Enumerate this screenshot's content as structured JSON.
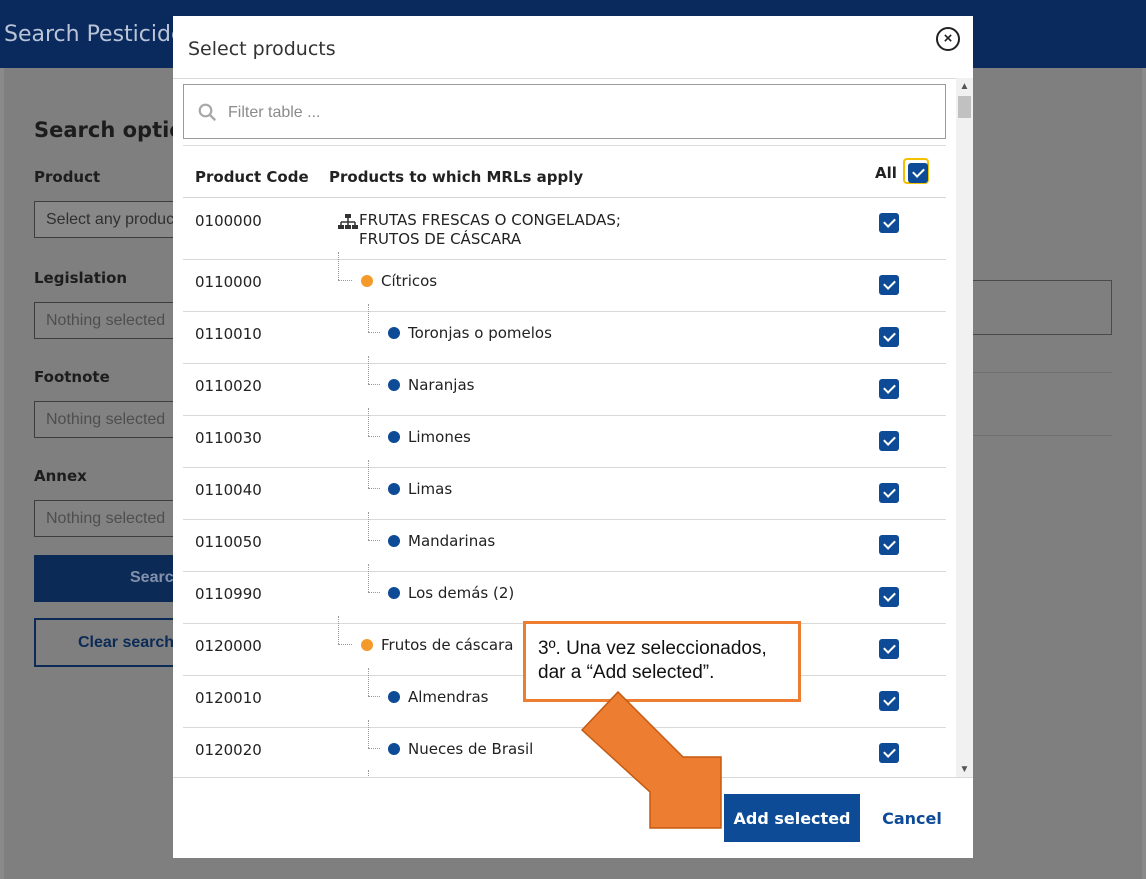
{
  "background": {
    "header_title": "Search Pesticide R",
    "section_title": "Search option",
    "product_label": "Product",
    "product_placeholder": "Select any product",
    "legislation_label": "Legislation",
    "legislation_value": "Nothing selected",
    "footnote_label": "Footnote",
    "footnote_value": "Nothing selected",
    "annex_label": "Annex",
    "annex_value": "Nothing selected",
    "search_button": "Search",
    "clear_button": "Clear search"
  },
  "modal": {
    "title": "Select products",
    "close_icon": "close-circle-icon",
    "filter_placeholder": "Filter table ...",
    "columns": {
      "code": "Product Code",
      "product": "Products to which MRLs apply",
      "all": "All"
    },
    "all_checked": true,
    "rows": [
      {
        "code": "0100000",
        "name": "FRUTAS FRESCAS O CONGELADAS;",
        "name2": "FRUTOS DE CÁSCARA",
        "level": 0,
        "checked": true
      },
      {
        "code": "0110000",
        "name": "Cítricos",
        "level": 1,
        "checked": true
      },
      {
        "code": "0110010",
        "name": "Toronjas o pomelos",
        "level": 2,
        "checked": true
      },
      {
        "code": "0110020",
        "name": "Naranjas",
        "level": 2,
        "checked": true
      },
      {
        "code": "0110030",
        "name": "Limones",
        "level": 2,
        "checked": true
      },
      {
        "code": "0110040",
        "name": "Limas",
        "level": 2,
        "checked": true
      },
      {
        "code": "0110050",
        "name": "Mandarinas",
        "level": 2,
        "checked": true
      },
      {
        "code": "0110990",
        "name": "Los demás (2)",
        "level": 2,
        "checked": true
      },
      {
        "code": "0120000",
        "name": "Frutos de cáscara",
        "level": 1,
        "checked": true
      },
      {
        "code": "0120010",
        "name": "Almendras",
        "level": 2,
        "checked": true
      },
      {
        "code": "0120020",
        "name": "Nueces de Brasil",
        "level": 2,
        "checked": true
      }
    ],
    "add_button": "Add selected",
    "cancel_button": "Cancel"
  },
  "annotation": {
    "line1": "3º. Una vez seleccionados,",
    "line2": "dar a “Add selected”.",
    "border_color": "#ed7d31",
    "arrow_color": "#ed7d31"
  },
  "colors": {
    "header_bg": "#0a2a5e",
    "primary": "#0d4b96",
    "level1_dot": "#f39a2b",
    "level2_dot": "#0d4b96",
    "all_focus_ring": "#f2c200"
  }
}
